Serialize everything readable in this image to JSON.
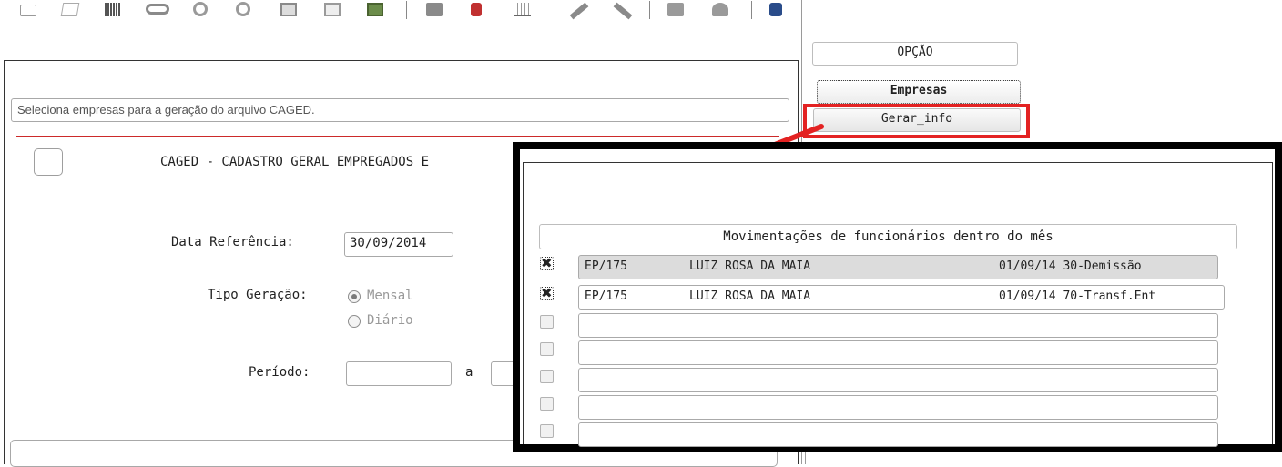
{
  "option_panel": {
    "header": "OPÇÃO",
    "items": [
      "Empresas",
      "Gerar_info"
    ]
  },
  "form": {
    "description": "Seleciona empresas para a geração do arquivo CAGED.",
    "title": "CAGED - CADASTRO GERAL EMPREGADOS E",
    "data_referencia_label": "Data Referência:",
    "data_referencia_value": "30/09/2014",
    "tipo_geracao_label": "Tipo Geração:",
    "tipo_geracao_options": [
      "Mensal",
      "Diário"
    ],
    "tipo_geracao_selected": "Mensal",
    "periodo_label": "Período:",
    "periodo_sep": "a"
  },
  "popup": {
    "title": "Movimentações de funcionários dentro do mês",
    "rows": [
      {
        "checked": true,
        "code": "EP/175",
        "name": "LUIZ ROSA DA MAIA",
        "date": "01/09/14",
        "movement": "30-Demissão"
      },
      {
        "checked": true,
        "code": "EP/175",
        "name": "LUIZ ROSA DA MAIA",
        "date": "01/09/14",
        "movement": "70-Transf.Ent"
      },
      {
        "checked": false,
        "code": "",
        "name": "",
        "date": "",
        "movement": ""
      },
      {
        "checked": false,
        "code": "",
        "name": "",
        "date": "",
        "movement": ""
      },
      {
        "checked": false,
        "code": "",
        "name": "",
        "date": "",
        "movement": ""
      },
      {
        "checked": false,
        "code": "",
        "name": "",
        "date": "",
        "movement": ""
      },
      {
        "checked": false,
        "code": "",
        "name": "",
        "date": "",
        "movement": ""
      }
    ]
  },
  "colors": {
    "highlight_red": "#e32222",
    "overlay_border": "#000000",
    "divider_red": "#cc2a2a"
  }
}
